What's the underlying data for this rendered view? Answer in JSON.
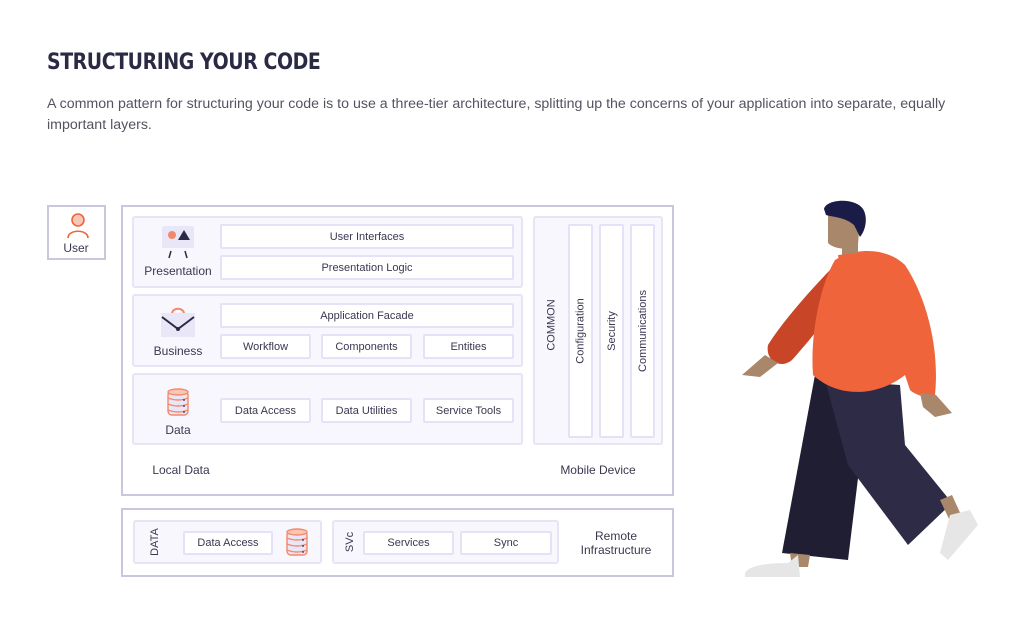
{
  "header": {
    "title": "STRUCTURING YOUR CODE",
    "intro": "A common pattern for structuring your code is to use a three-tier architecture, splitting up the concerns of your application into separate, equally important layers."
  },
  "user": {
    "label": "User",
    "icon": "user-icon"
  },
  "mobile_device": {
    "label": "Mobile Device",
    "local_label": "Local Data",
    "layers": [
      {
        "name": "Presentation",
        "icon": "easel-icon",
        "rows": [
          [
            "User Interfaces"
          ],
          [
            "Presentation Logic"
          ]
        ]
      },
      {
        "name": "Business",
        "icon": "envelope-icon",
        "rows": [
          [
            "Application Facade"
          ],
          [
            "Workflow",
            "Components",
            "Entities"
          ]
        ]
      },
      {
        "name": "Data",
        "icon": "database-icon",
        "rows": [
          [
            "Data Access",
            "Data Utilities",
            "Service Tools"
          ]
        ]
      }
    ],
    "common": {
      "label": "COMMON",
      "items": [
        "Configuration",
        "Security",
        "Communications"
      ]
    }
  },
  "remote": {
    "label": "Remote Infrastructure",
    "data": {
      "label": "DATA",
      "item": "Data Access",
      "icon": "database-icon"
    },
    "svc": {
      "label": "SVc",
      "items": [
        "Services",
        "Sync"
      ]
    }
  },
  "illustration": {
    "description": "walking-person-illustration"
  },
  "colors": {
    "accent": "#f0643c",
    "navy": "#2b2a45",
    "border": "#c9c6dd"
  }
}
